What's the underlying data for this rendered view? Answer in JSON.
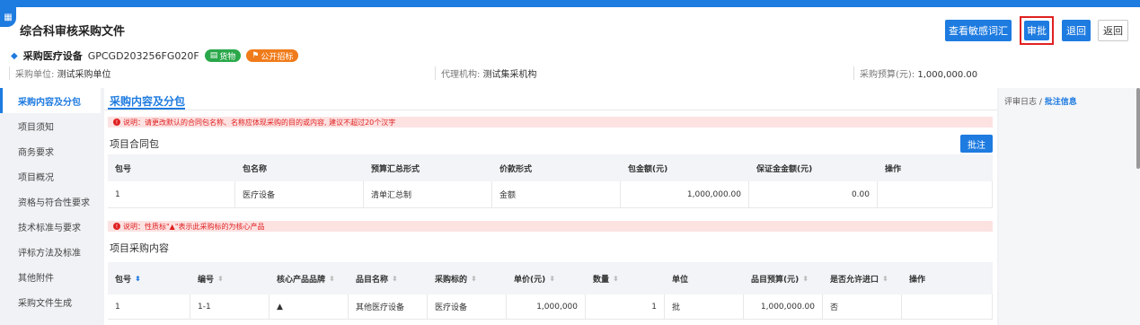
{
  "header": {
    "title": "综合科审核采购文件",
    "buttons": {
      "sensitive": "查看敏感词汇",
      "approve": "审批",
      "reject": "退回",
      "back": "返回"
    },
    "project": {
      "name": "采购医疗设备",
      "code": "GPCGD203256FG020F",
      "tag_goods": "货物",
      "tag_bid": "公开招标"
    },
    "meta": {
      "unit_label": "采购单位:",
      "unit_value": "测试采购单位",
      "agency_label": "代理机构:",
      "agency_value": "测试集采机构",
      "budget_label": "采购预算(元):",
      "budget_value": "1,000,000.00"
    }
  },
  "sidebar": {
    "items": [
      "采购内容及分包",
      "项目须知",
      "商务要求",
      "项目概况",
      "资格与符合性要求",
      "技术标准与要求",
      "评标方法及标准",
      "其他附件",
      "采购文件生成"
    ],
    "active_index": 0
  },
  "main": {
    "section_title": "采购内容及分包",
    "notice1": "说明：请更改默认的合同包名称、名称应体现采购的目的或内容, 建议不超过20个汉字",
    "contract_title": "项目合同包",
    "note_button": "批注",
    "contract_table": {
      "headers": [
        "包号",
        "包名称",
        "预算汇总形式",
        "价款形式",
        "包金额(元)",
        "保证金金额(元)",
        "操作"
      ],
      "rows": [
        [
          "1",
          "医疗设备",
          "清单汇总制",
          "金额",
          "1,000,000.00",
          "0.00",
          ""
        ]
      ]
    },
    "notice2": "说明：性质标\"▲\"表示此采购标的为核心产品",
    "content_title": "项目采购内容",
    "content_table": {
      "headers": [
        "包号",
        "编号",
        "核心产品品牌",
        "品目名称",
        "采购标的",
        "单价(元)",
        "数量",
        "单位",
        "品目预算(元)",
        "是否允许进口",
        "操作"
      ],
      "rows": [
        [
          "1",
          "1-1",
          "▲",
          "其他医疗设备",
          "医疗设备",
          "1,000,000",
          "1",
          "批",
          "1,000,000.00",
          "否",
          ""
        ]
      ]
    }
  },
  "rightpanel": {
    "label": "评审日志 /",
    "active": "批注信息"
  }
}
